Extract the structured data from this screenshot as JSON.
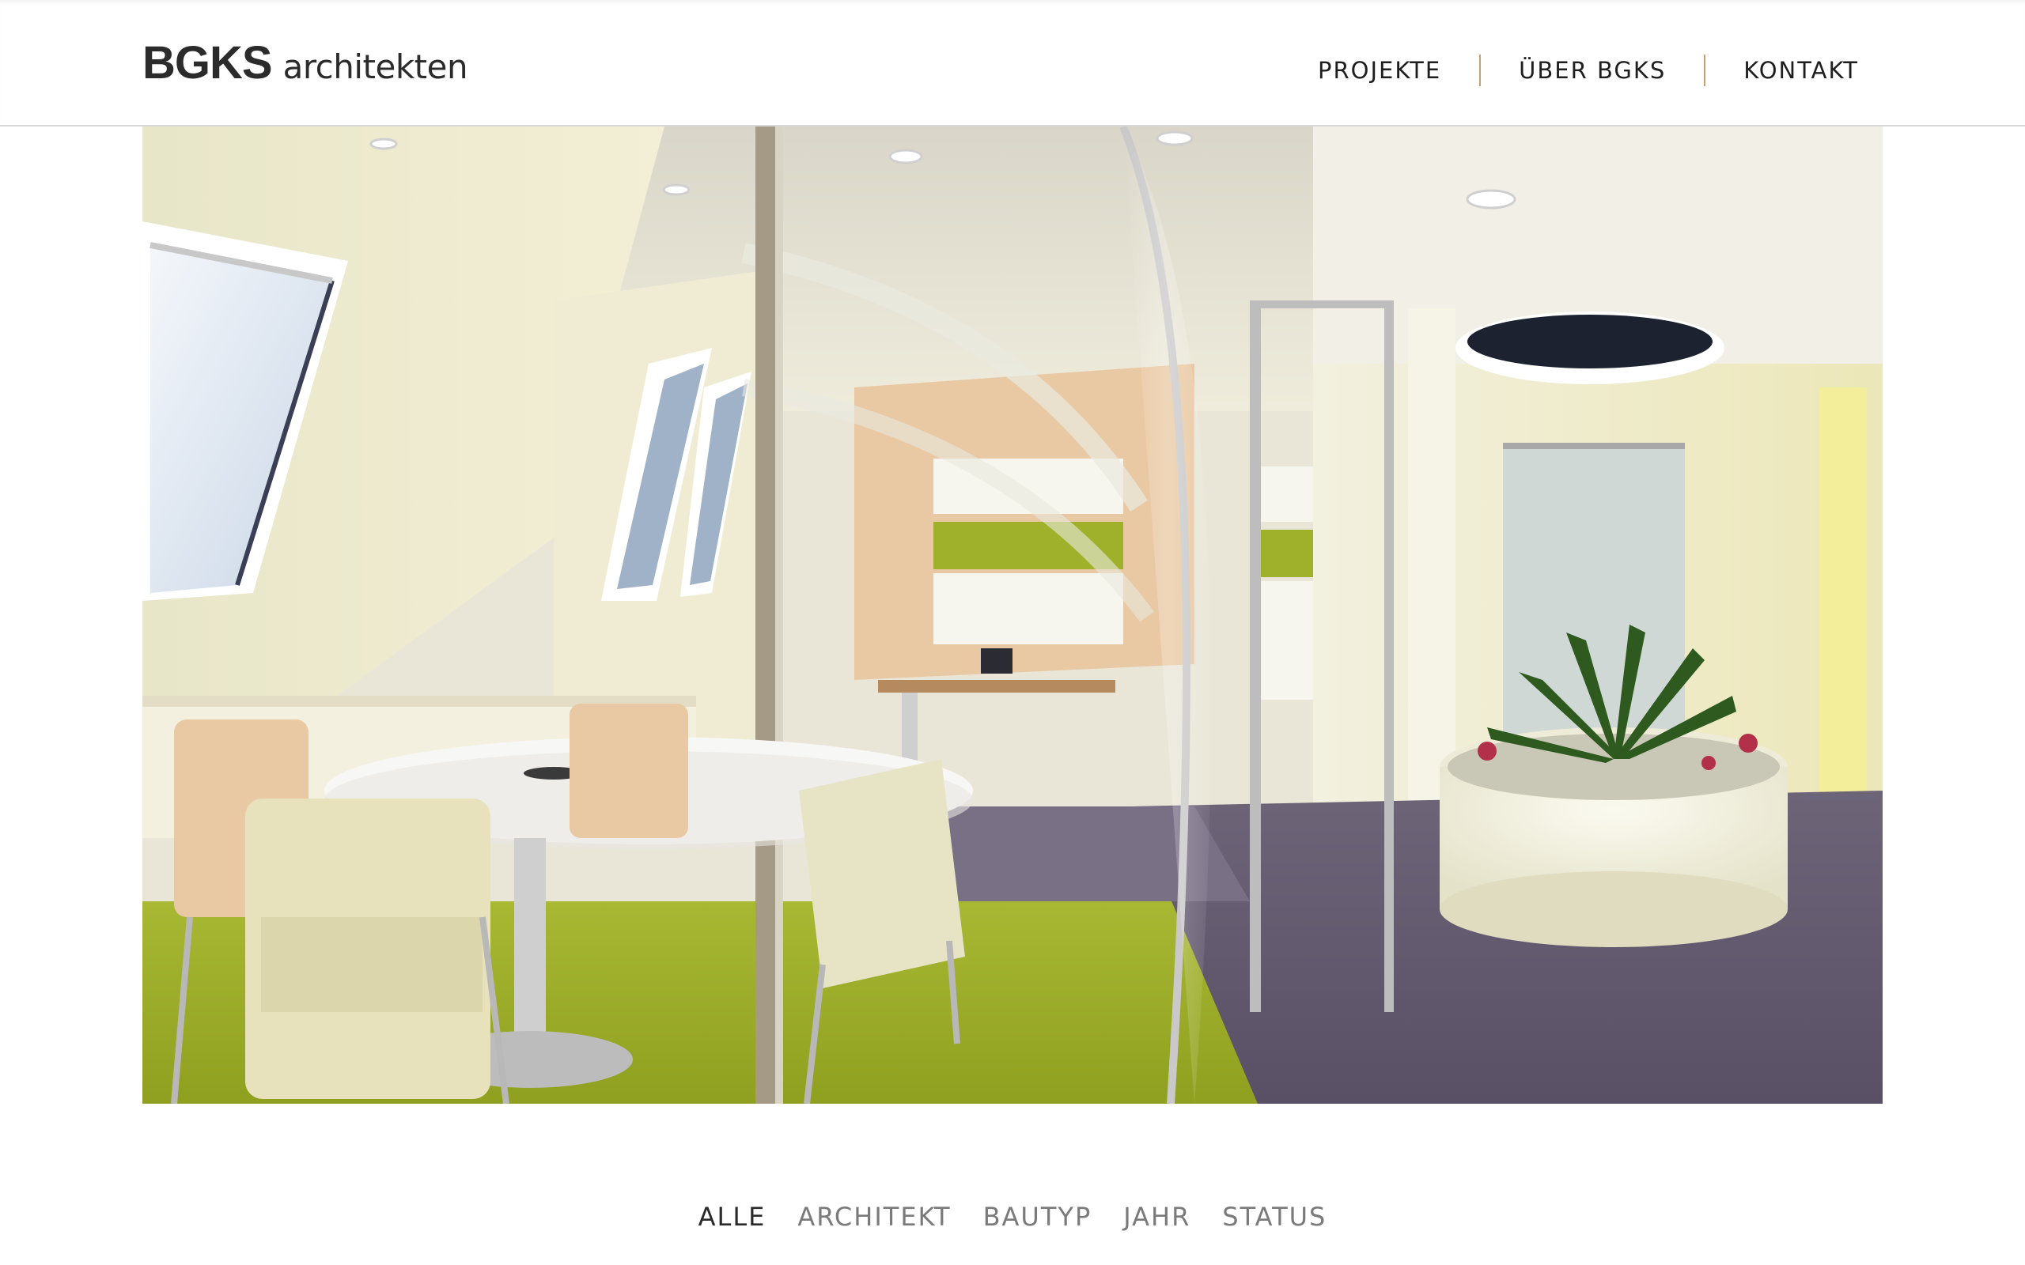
{
  "brand": {
    "mark": "BGKS",
    "word": "architekten"
  },
  "nav": {
    "items": [
      {
        "label": "PROJEKTE"
      },
      {
        "label": "ÜBER BGKS"
      },
      {
        "label": "KONTAKT"
      }
    ]
  },
  "colors": {
    "nav_separator": "#c8a06a",
    "text_dark": "#1e1e1e",
    "filter_inactive": "#7a7a7a"
  },
  "filters": {
    "items": [
      {
        "label": "ALLE",
        "active": true
      },
      {
        "label": "ARCHITEKT",
        "active": false
      },
      {
        "label": "BAUTYP",
        "active": false
      },
      {
        "label": "JAHR",
        "active": false
      },
      {
        "label": "STATUS",
        "active": false
      }
    ]
  }
}
